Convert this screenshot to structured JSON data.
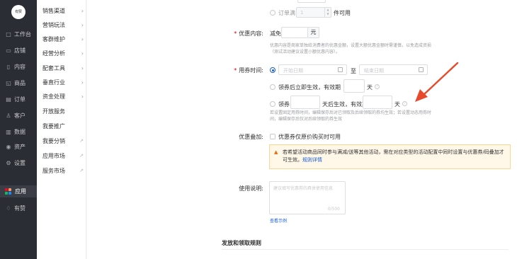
{
  "logo_text": "有赞",
  "primary_nav": [
    {
      "icon": "shop-icon",
      "glyph": "□",
      "label": "工作台"
    },
    {
      "icon": "store-icon",
      "glyph": "▭",
      "label": "店铺"
    },
    {
      "icon": "content-icon",
      "glyph": "▯",
      "label": "内容"
    },
    {
      "icon": "goods-icon",
      "glyph": "◱",
      "label": "商品"
    },
    {
      "icon": "order-icon",
      "glyph": "▤",
      "label": "订单"
    },
    {
      "icon": "customer-icon",
      "glyph": "♙",
      "label": "客户"
    },
    {
      "icon": "data-icon",
      "glyph": "▥",
      "label": "数据"
    },
    {
      "icon": "asset-icon",
      "glyph": "◉",
      "label": "资产"
    },
    {
      "icon": "settings-icon",
      "glyph": "⚙",
      "label": "设置"
    },
    {
      "icon": "apps-icon",
      "glyph": "",
      "label": "应用"
    },
    {
      "icon": "like-icon",
      "glyph": "♢",
      "label": "有赞"
    }
  ],
  "secondary_nav": [
    {
      "label": "销售渠道",
      "suffix": "›"
    },
    {
      "label": "营销玩法",
      "suffix": "›"
    },
    {
      "label": "客群维护",
      "suffix": "›"
    },
    {
      "label": "经营分析",
      "suffix": "›"
    },
    {
      "label": "配套工具",
      "suffix": "›"
    },
    {
      "label": "垂直行业",
      "suffix": "›"
    },
    {
      "label": "资金处理",
      "suffix": "›"
    },
    {
      "label": "开放服务",
      "suffix": ""
    },
    {
      "label": "我要推广",
      "suffix": ""
    },
    {
      "label": "我要分销",
      "suffix": "↗"
    },
    {
      "label": "应用市场",
      "suffix": "↗"
    },
    {
      "label": "服务市场",
      "suffix": "↗"
    }
  ],
  "threshold": {
    "prefix": "订单满",
    "value": "1",
    "suffix": "件可用"
  },
  "discount": {
    "label": "优惠内容:",
    "prefix": "减免",
    "value": "",
    "unit": "元",
    "help": "优惠内容是商家单独给消费者的优惠金额，设置大额优惠金额时需谨慎，以免造成资损（测试活动建议设置小额优惠内容）。"
  },
  "validity": {
    "label": "用券时间:",
    "start_placeholder": "开始日期",
    "to": "至",
    "end_placeholder": "结束日期",
    "option2_prefix": "领券后立即生效，有效期",
    "option2_unit": "天",
    "option3_prefix": "领券",
    "option3_mid": "天后生效，有效期",
    "option3_unit": "天",
    "help": "若设置固定用券时间，编辑保存后对已领取及后续领取的券均生效；若设置动态用券时间，编辑保存后仅对后续领取的券生效"
  },
  "stacking": {
    "label": "优惠叠加:",
    "checkbox_label": "优惠券仅原价购买时可用",
    "warning_text": "若希望活动商品同时参与满减/送等其他活动，需在对应类型的活动配置中同时设置与优惠券/码叠加才可生效。",
    "warning_link": "规则详情"
  },
  "usage": {
    "label": "使用说明:",
    "placeholder": "建议填写优惠券的具体使用信息",
    "counter": "0/500",
    "example_link": "查看示例"
  },
  "section_title": "发放和领取规则",
  "colors": {
    "primary": "#155bd4",
    "warning": "#ed6a0c",
    "required": "#d40000",
    "sidebar": "#2a2d33",
    "arrow": "#e8492b"
  }
}
